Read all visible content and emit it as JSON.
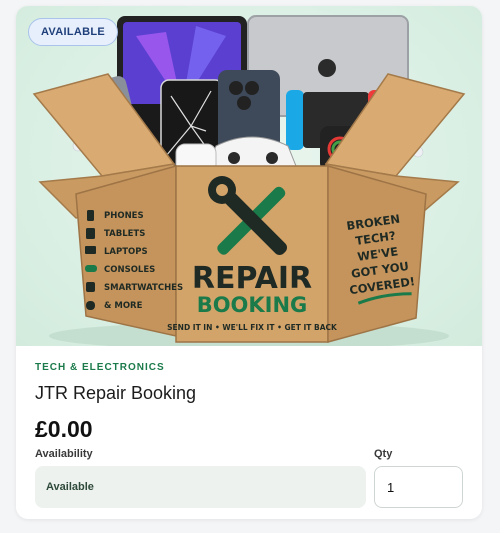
{
  "product": {
    "badge": "AVAILABLE",
    "category": "TECH & ELECTRONICS",
    "title": "JTR Repair Booking",
    "price": "£0.00",
    "availability_label": "Availability",
    "availability_value": "Available",
    "qty_label": "Qty",
    "qty_value": "1"
  },
  "hero_image": {
    "box_left_list": [
      "PHONES",
      "TABLETS",
      "LAPTOPS",
      "CONSOLES",
      "SMARTWATCHES",
      "& MORE"
    ],
    "box_title_line1": "REPAIR",
    "box_title_line2": "BOOKING",
    "box_tagline": "SEND IT IN • WE'LL FIX IT • GET IT BACK",
    "box_right_line1": "BROKEN",
    "box_right_line2": "TECH?",
    "box_right_line3": "WE'VE",
    "box_right_line4": "GOT YOU",
    "box_right_line5": "COVERED!"
  },
  "colors": {
    "accent_green": "#1a7a4a",
    "badge_bg": "#e7effc",
    "badge_text": "#1f3f7a",
    "cardboard": "#c99a62"
  }
}
